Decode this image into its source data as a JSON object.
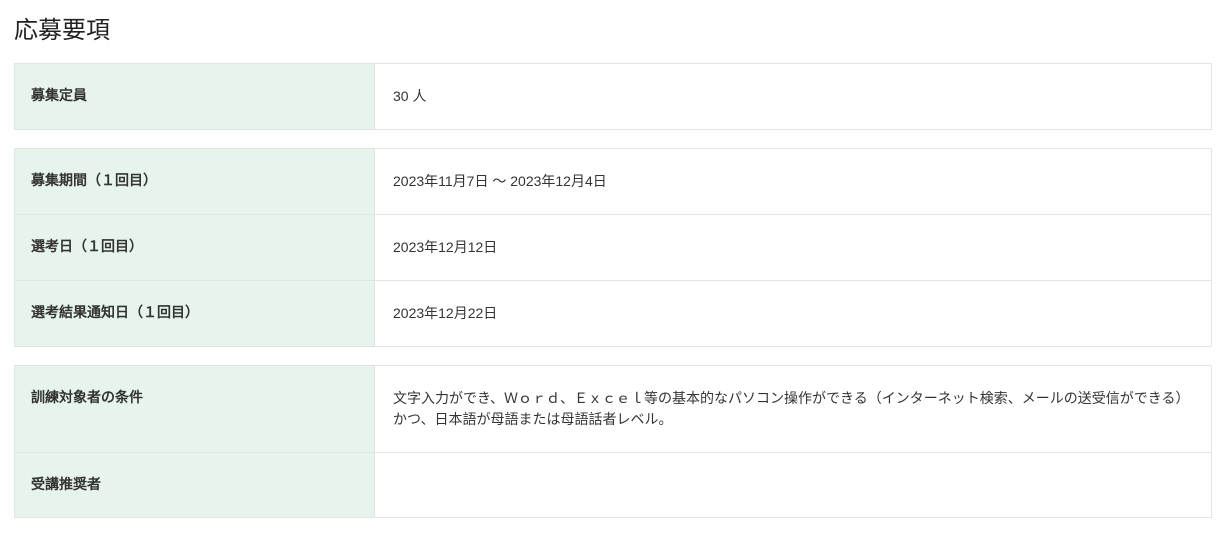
{
  "title": "応募要項",
  "blocks": [
    {
      "rows": [
        {
          "label": "募集定員",
          "value": "30 人"
        }
      ]
    },
    {
      "rows": [
        {
          "label": "募集期間（１回目）",
          "value": "2023年11月7日 ～ 2023年12月4日"
        },
        {
          "label": "選考日（１回目）",
          "value": "2023年12月12日"
        },
        {
          "label": "選考結果通知日（１回目）",
          "value": "2023年12月22日"
        }
      ]
    },
    {
      "rows": [
        {
          "label": "訓練対象者の条件",
          "value": "文字入力ができ、Ｗｏｒｄ、Ｅｘｃｅｌ等の基本的なパソコン操作ができる（インターネット検索、メールの送受信ができる）かつ、日本語が母語または母語話者レベル。"
        },
        {
          "label": "受講推奨者",
          "value": ""
        }
      ]
    }
  ]
}
